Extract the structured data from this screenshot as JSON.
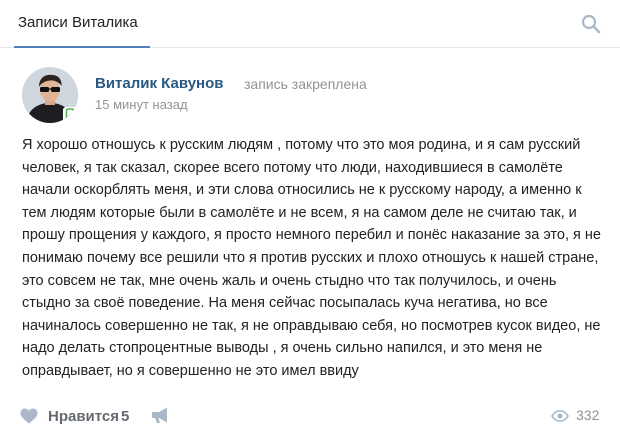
{
  "header": {
    "tab_label": "Записи Виталика",
    "search_icon": "search-icon"
  },
  "post": {
    "author": "Виталик Кавунов",
    "status": "запись закреплена",
    "timestamp": "15 минут назад",
    "avatar_icon": "avatar",
    "platform_icon": "mobile-icon",
    "text": "Я хорошо отношусь к русским людям , потому что это моя родина, и я сам русский человек, я так сказал, скорее всего потому что люди, находившиеся в самолёте начали оскорблять меня, и эти слова относились не к русскому народу, а именно к тем людям которые были в самолёте и не всем, я на самом деле не считаю так, и прошу прощения у каждого, я просто немного перебил и понёс наказание за это, я не понимаю почему все решили что я против русских и плохо отношусь к нашей стране, это совсем не так, мне очень жаль и очень стыдно что так получилось, и очень стыдно за своё поведение. На меня сейчас посыпалась куча негатива, но все начиналось совершенно не так, я не оправдываю себя, но посмотрев кусок видео, не надо делать стопроцентные выводы , я очень сильно напился, и это меня не оправдывает, но я совершенно не это имел ввиду"
  },
  "footer": {
    "like_label": "Нравится",
    "like_count": "5",
    "views_count": "332",
    "like_icon": "heart-icon",
    "share_icon": "megaphone-icon",
    "views_icon": "eye-icon"
  },
  "colors": {
    "link": "#2a5885",
    "muted": "#939393",
    "accent": "#5181b8",
    "icon": "#aab8c8"
  }
}
